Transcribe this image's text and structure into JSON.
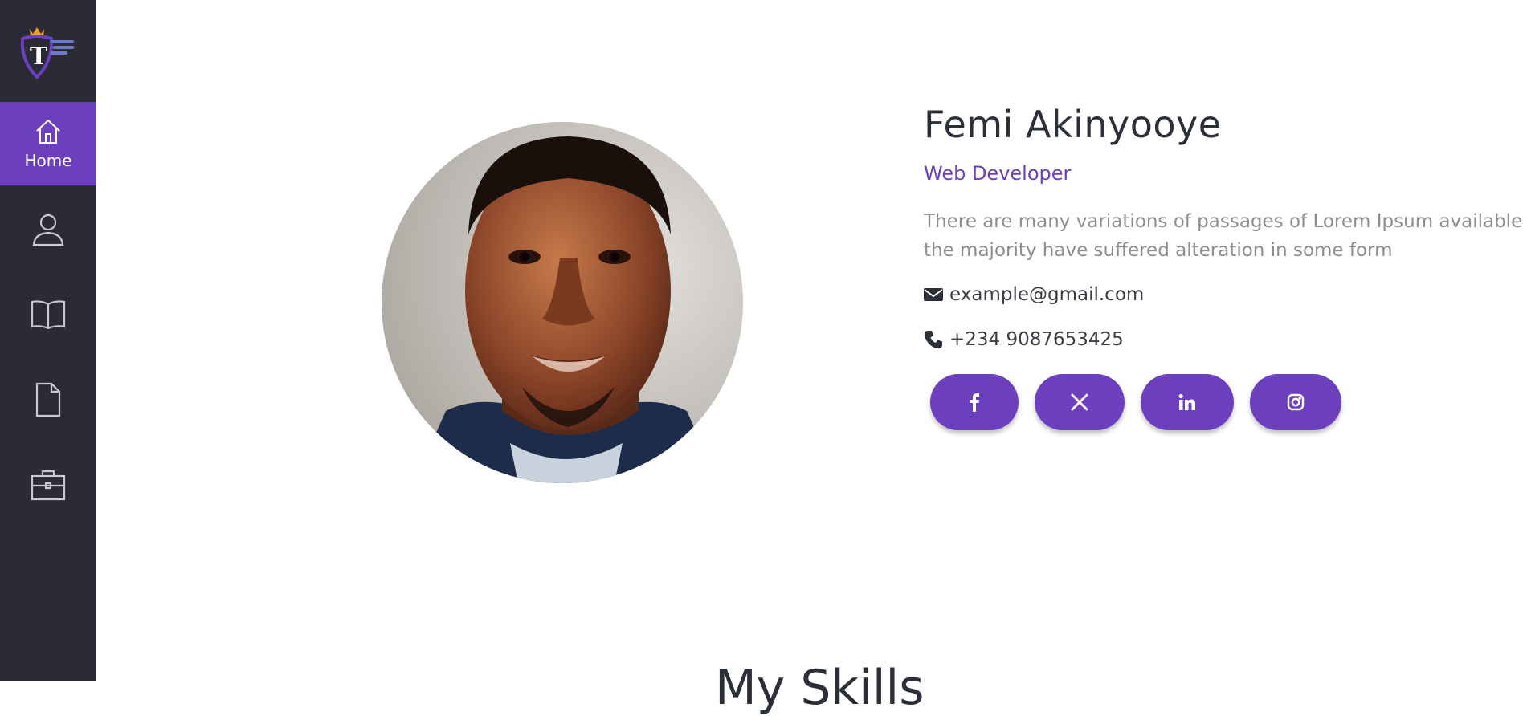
{
  "sidebar": {
    "logo": {
      "letter": "T",
      "icon": "crown-shield-logo"
    },
    "items": [
      {
        "icon": "home-icon",
        "label": "Home",
        "active": true
      },
      {
        "icon": "user-icon",
        "label": ""
      },
      {
        "icon": "book-icon",
        "label": ""
      },
      {
        "icon": "document-icon",
        "label": ""
      },
      {
        "icon": "briefcase-icon",
        "label": ""
      }
    ]
  },
  "profile": {
    "name": "Femi Akinyooye",
    "role": "Web Developer",
    "description": "There are many variations of passages of Lorem Ipsum available, but the majority have suffered alteration in some form",
    "email": "example@gmail.com",
    "phone": "+234 9087653425",
    "socials": [
      {
        "icon": "facebook-icon"
      },
      {
        "icon": "x-icon"
      },
      {
        "icon": "linkedin-icon"
      },
      {
        "icon": "instagram-icon"
      }
    ]
  },
  "skills": {
    "title": "My Skills"
  },
  "colors": {
    "accent": "#6c3fbf",
    "sidebar": "#2a2b34",
    "text": "#2b2f38",
    "muted": "#8a8d92"
  }
}
